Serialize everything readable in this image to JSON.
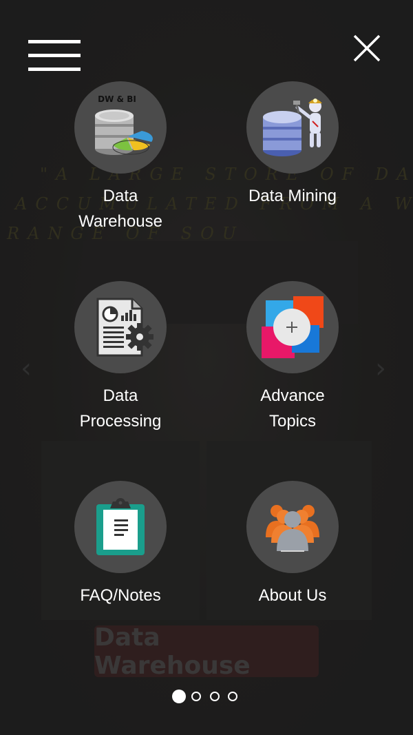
{
  "background": {
    "quote_lines": [
      "\"A LARGE STORE OF DATA",
      "ACCUMULATED FROM A WIDE",
      "RANGE OF SOU"
    ],
    "button_label": "Data Warehouse",
    "prev_arrow": "‹",
    "next_arrow": "›"
  },
  "header": {
    "menu_icon": "hamburger-icon",
    "close_icon": "close-icon"
  },
  "menu": {
    "items": [
      {
        "label_lines": [
          "Data",
          "Warehouse"
        ],
        "icon": "database-chart-icon",
        "badge": "DW & BI"
      },
      {
        "label_lines": [
          "Data Mining"
        ],
        "icon": "database-miner-icon"
      },
      {
        "label_lines": [
          "Data",
          "Processing"
        ],
        "icon": "document-gear-icon"
      },
      {
        "label_lines": [
          "Advance",
          "Topics"
        ],
        "icon": "plus-tiles-icon"
      },
      {
        "label_lines": [
          "FAQ/Notes"
        ],
        "icon": "clipboard-icon"
      },
      {
        "label_lines": [
          "About Us"
        ],
        "icon": "people-group-icon"
      }
    ]
  },
  "pagination": {
    "count": 4,
    "active": 0
  },
  "colors": {
    "circle": "#4b4b4b",
    "text": "#ffffff",
    "background": "#1e1e1f"
  }
}
